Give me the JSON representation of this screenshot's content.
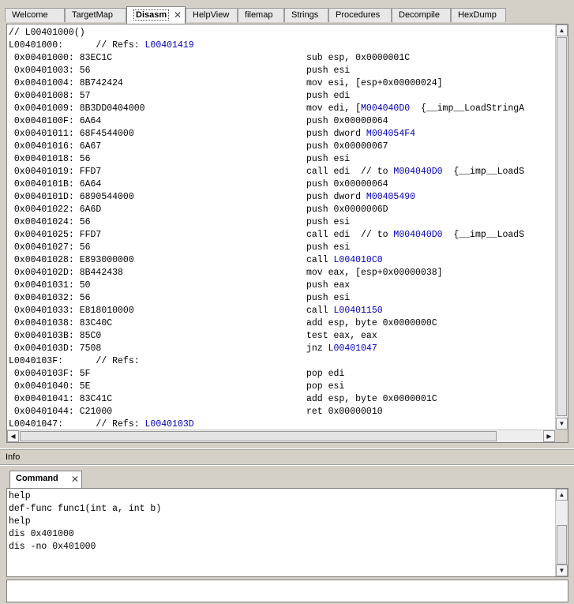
{
  "tabs": [
    {
      "label": "Welcome",
      "active": false
    },
    {
      "label": "TargetMap",
      "active": false
    },
    {
      "label": "Disasm",
      "active": true
    },
    {
      "label": "HelpView",
      "active": false
    },
    {
      "label": "filemap",
      "active": false
    },
    {
      "label": "Strings",
      "active": false
    },
    {
      "label": "Procedures",
      "active": false
    },
    {
      "label": "Decompile",
      "active": false
    },
    {
      "label": "HexDump",
      "active": false
    }
  ],
  "close_glyph": "✕",
  "disasm": {
    "lines": [
      {
        "addr": "// L00401000()",
        "ins": ""
      },
      {
        "addr": "L00401000:      // Refs: ",
        "addr_ref": "L00401419",
        "ins": ""
      },
      {
        "addr": " 0x00401000: 83EC1C",
        "ins": "sub esp, 0x0000001C"
      },
      {
        "addr": " 0x00401003: 56",
        "ins": "push esi"
      },
      {
        "addr": " 0x00401004: 8B742424",
        "ins": "mov esi, [esp+0x00000024]"
      },
      {
        "addr": " 0x00401008: 57",
        "ins": "push edi"
      },
      {
        "addr": " 0x00401009: 8B3DD0404000",
        "ins": "mov edi, [",
        "ins_ref": "M004040D0",
        "ins_tail": "  {__imp__LoadStringA"
      },
      {
        "addr": " 0x0040100F: 6A64",
        "ins": "push 0x00000064"
      },
      {
        "addr": " 0x00401011: 68F4544000",
        "ins": "push dword ",
        "ins_ref": "M004054F4"
      },
      {
        "addr": " 0x00401016: 6A67",
        "ins": "push 0x00000067"
      },
      {
        "addr": " 0x00401018: 56",
        "ins": "push esi"
      },
      {
        "addr": " 0x00401019: FFD7",
        "ins": "call edi  // to ",
        "ins_ref": "M004040D0",
        "ins_tail": "  {__imp__LoadS"
      },
      {
        "addr": " 0x0040101B: 6A64",
        "ins": "push 0x00000064"
      },
      {
        "addr": " 0x0040101D: 6890544000",
        "ins": "push dword ",
        "ins_ref": "M00405490"
      },
      {
        "addr": " 0x00401022: 6A6D",
        "ins": "push 0x0000006D"
      },
      {
        "addr": " 0x00401024: 56",
        "ins": "push esi"
      },
      {
        "addr": " 0x00401025: FFD7",
        "ins": "call edi  // to ",
        "ins_ref": "M004040D0",
        "ins_tail": "  {__imp__LoadS"
      },
      {
        "addr": " 0x00401027: 56",
        "ins": "push esi"
      },
      {
        "addr": " 0x00401028: E893000000",
        "ins": "call ",
        "ins_ref": "L004010C0"
      },
      {
        "addr": " 0x0040102D: 8B442438",
        "ins": "mov eax, [esp+0x00000038]"
      },
      {
        "addr": " 0x00401031: 50",
        "ins": "push eax"
      },
      {
        "addr": " 0x00401032: 56",
        "ins": "push esi"
      },
      {
        "addr": " 0x00401033: E818010000",
        "ins": "call ",
        "ins_ref": "L00401150"
      },
      {
        "addr": " 0x00401038: 83C40C",
        "ins": "add esp, byte 0x0000000C"
      },
      {
        "addr": " 0x0040103B: 85C0",
        "ins": "test eax, eax"
      },
      {
        "addr": " 0x0040103D: 7508",
        "ins": "jnz ",
        "ins_ref": "L00401047"
      },
      {
        "addr": "L0040103F:      // Refs:",
        "ins": ""
      },
      {
        "addr": " 0x0040103F: 5F",
        "ins": "pop edi"
      },
      {
        "addr": " 0x00401040: 5E",
        "ins": "pop esi"
      },
      {
        "addr": " 0x00401041: 83C41C",
        "ins": "add esp, byte 0x0000001C"
      },
      {
        "addr": " 0x00401044: C21000",
        "ins": "ret 0x00000010"
      },
      {
        "addr": "L00401047:      // Refs: ",
        "addr_ref": "L0040103D",
        "ins": ""
      }
    ]
  },
  "info_label": "Info",
  "command": {
    "tab_label": "Command",
    "history": [
      "help",
      "def-func func1(int a, int b)",
      "help",
      "dis 0x401000",
      "dis -no 0x401000"
    ],
    "input_value": ""
  },
  "colors": {
    "ref": "#0000b4",
    "panel_bg": "#d4d0c8"
  }
}
